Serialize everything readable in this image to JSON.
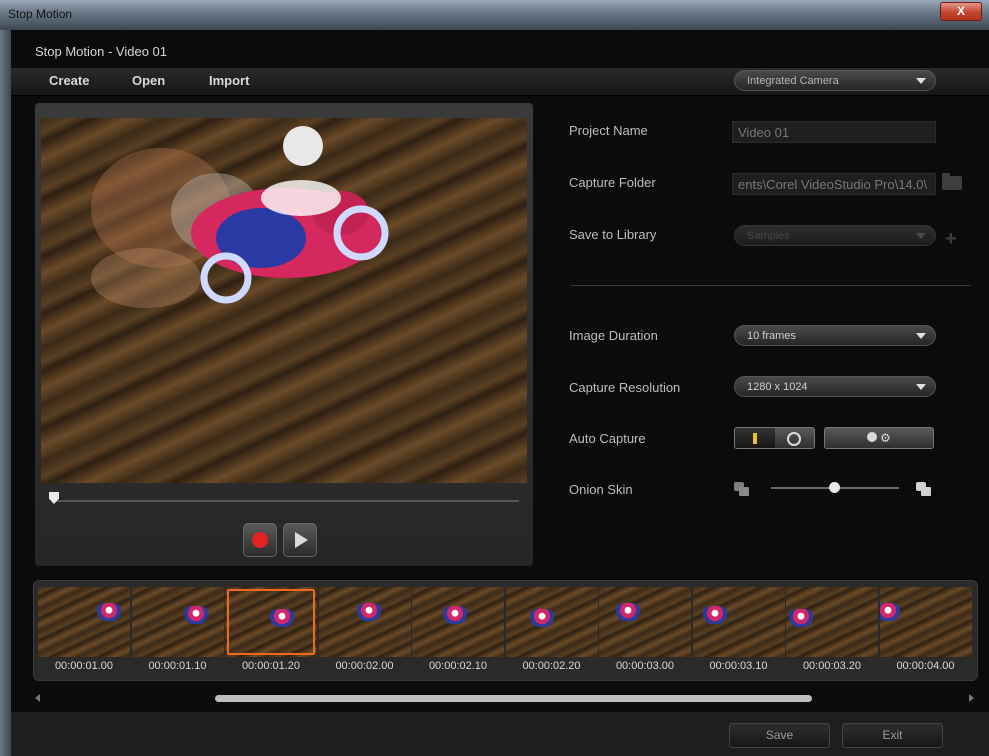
{
  "window": {
    "title": "Stop Motion",
    "close_glyph": "X"
  },
  "app": {
    "title": "Stop Motion - Video 01"
  },
  "menu": {
    "items": [
      "Create",
      "Open",
      "Import"
    ]
  },
  "camera": {
    "selected": "Integrated Camera",
    "icon": "chevron-down-icon"
  },
  "settings": {
    "project_name_label": "Project Name",
    "project_name_value": "Video 01",
    "capture_folder_label": "Capture Folder",
    "capture_folder_value": "ents\\Corel VideoStudio Pro\\14.0\\",
    "save_to_library_label": "Save to Library",
    "save_to_library_value": "Samples",
    "image_duration_label": "Image Duration",
    "image_duration_value": "10 frames",
    "capture_resolution_label": "Capture Resolution",
    "capture_resolution_value": "1280 x 1024",
    "auto_capture_label": "Auto Capture",
    "onion_skin_label": "Onion Skin",
    "onion_skin_level": 0.5
  },
  "playback": {
    "position": 0
  },
  "filmstrip": {
    "selected_index": 2,
    "frames": [
      "00:00:01.00",
      "00:00:01.10",
      "00:00:01.20",
      "00:00:02.00",
      "00:00:02.10",
      "00:00:02.20",
      "00:00:03.00",
      "00:00:03.10",
      "00:00:03.20",
      "00:00:04.00"
    ]
  },
  "footer": {
    "save_label": "Save",
    "exit_label": "Exit"
  },
  "colors": {
    "record": "#e3231f",
    "selection": "#f06a1e",
    "toggle_active": "#f0c020"
  }
}
